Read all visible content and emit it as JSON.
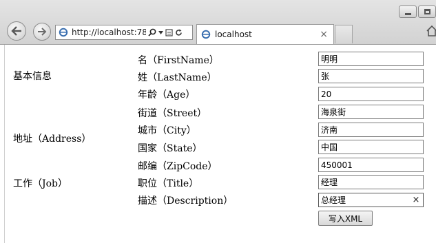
{
  "browser": {
    "url": "http://localhost:78",
    "tab_title": "localhost",
    "tab_close": "×"
  },
  "groups": [
    {
      "label": "基本信息"
    },
    {
      "label": "地址（Address）"
    },
    {
      "label": "工作（Job）"
    }
  ],
  "fields": [
    {
      "label": "名（FirstName）",
      "value": "明明"
    },
    {
      "label": "姓（LastName）",
      "value": "张"
    },
    {
      "label": "年龄（Age）",
      "value": "20"
    },
    {
      "label": "街道（Street）",
      "value": "海泉街"
    },
    {
      "label": "城市（City）",
      "value": "济南"
    },
    {
      "label": "国家（State）",
      "value": "中国"
    },
    {
      "label": "邮编（ZipCode）",
      "value": "450001"
    },
    {
      "label": "职位（Title）",
      "value": "经理"
    },
    {
      "label": "描述（Description）",
      "value": "总经理"
    }
  ],
  "clear_glyph": "×",
  "submit_label": "写入XML"
}
